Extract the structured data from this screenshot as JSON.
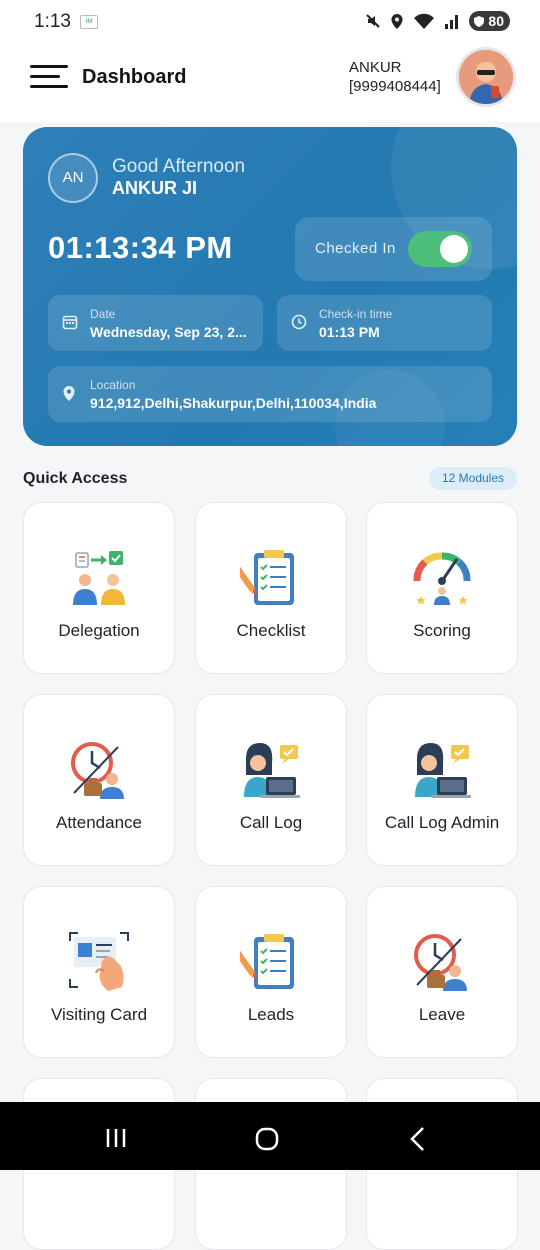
{
  "status_bar": {
    "time": "1:13",
    "battery": "80"
  },
  "header": {
    "title": "Dashboard",
    "user_name": "ANKUR",
    "user_phone": "[9999408444]"
  },
  "attendance_card": {
    "initials": "AN",
    "greeting": "Good Afternoon",
    "name": "ANKUR JI",
    "clock": "01:13:34 PM",
    "checked_in_label": "Checked In",
    "checked_in": true,
    "date_label": "Date",
    "date_value": "Wednesday, Sep 23, 2...",
    "checkin_label": "Check-in time",
    "checkin_value": "01:13 PM",
    "location_label": "Location",
    "location_value": "912,912,Delhi,Shakurpur,Delhi,110034,India"
  },
  "quick_access": {
    "title": "Quick Access",
    "badge": "12 Modules",
    "modules": [
      {
        "label": "Delegation",
        "icon": "delegation-icon"
      },
      {
        "label": "Checklist",
        "icon": "checklist-icon"
      },
      {
        "label": "Scoring",
        "icon": "scoring-gauge-icon"
      },
      {
        "label": "Attendance",
        "icon": "attendance-clock-icon"
      },
      {
        "label": "Call Log",
        "icon": "call-log-icon"
      },
      {
        "label": "Call Log Admin",
        "icon": "call-log-admin-icon"
      },
      {
        "label": "Visiting Card",
        "icon": "visiting-card-icon"
      },
      {
        "label": "Leads",
        "icon": "leads-clipboard-icon"
      },
      {
        "label": "Leave",
        "icon": "leave-clock-icon"
      }
    ]
  },
  "colors": {
    "card_blue": "#2379b1",
    "toggle_green": "#4cbf7b",
    "badge_blue": "#2a78b0"
  }
}
